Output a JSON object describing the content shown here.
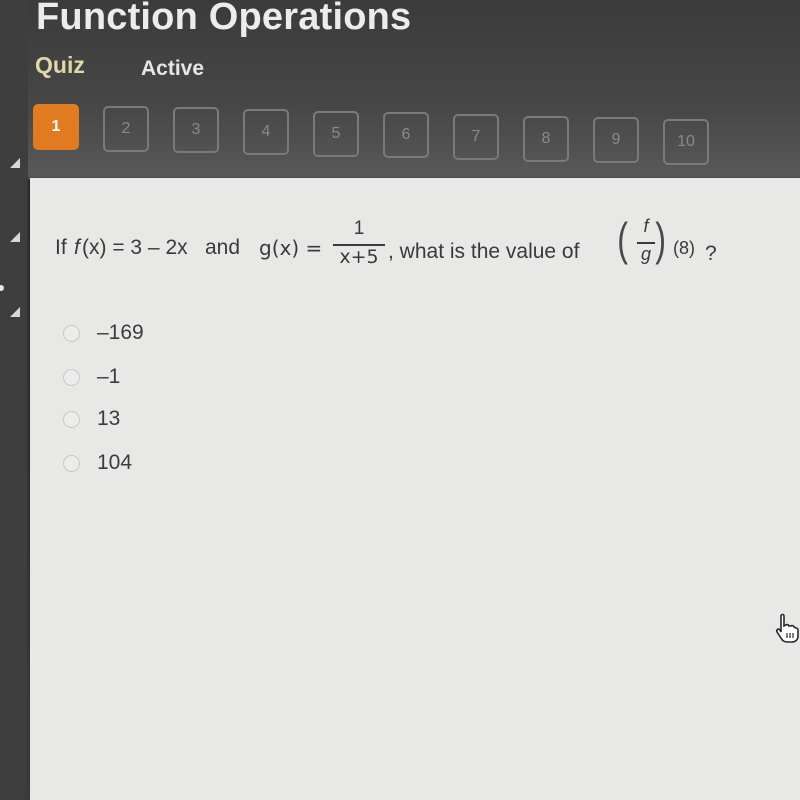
{
  "header": {
    "title": "Function Operations",
    "type_label": "Quiz",
    "status_label": "Active"
  },
  "question_nav": {
    "current": 1,
    "accent_color": "#e07b22",
    "items": [
      "1",
      "2",
      "3",
      "4",
      "5",
      "6",
      "7",
      "8",
      "9",
      "10"
    ]
  },
  "question": {
    "prefix": "If ",
    "f_name": "f",
    "f_def": "(x) = 3 – 2x",
    "and_text": " and ",
    "g_def": "g(x) =",
    "g_numerator": "1",
    "g_denominator": "x+5",
    "middle": ", what is the value of",
    "quot_numerator": "f",
    "quot_denominator": "g",
    "arg": "(8)",
    "suffix": "?"
  },
  "answers": [
    {
      "label": "–169",
      "selected": false
    },
    {
      "label": "–1",
      "selected": false
    },
    {
      "label": "13",
      "selected": false
    },
    {
      "label": "104",
      "selected": false
    }
  ],
  "cursor": {
    "icon": "hand-pointer-icon"
  }
}
